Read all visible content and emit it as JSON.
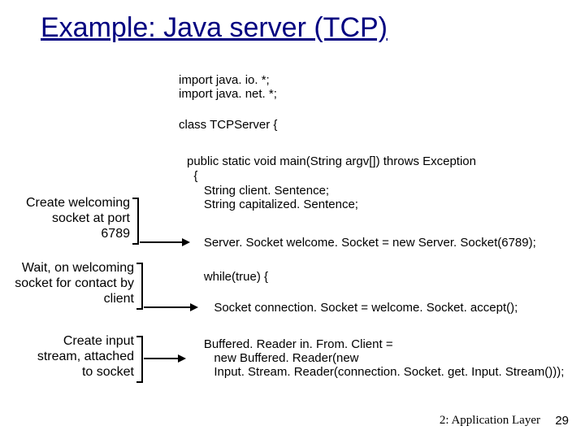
{
  "title": "Example: Java server (TCP)",
  "code": {
    "imports": "import java. io. *;\nimport java. net. *;",
    "classdecl": "class TCPServer {",
    "mainsig": "public static void main(String argv[]) throws Exception",
    "brace": "  {",
    "decls": "     String client. Sentence;\n     String capitalized. Sentence;",
    "welcome": "     Server. Socket welcome. Socket = new Server. Socket(6789);",
    "whileline": "     while(true) {",
    "accept": "        Socket connection. Socket = welcome. Socket. accept();",
    "reader": "     Buffered. Reader in. From. Client =\n        new Buffered. Reader(new\n        Input. Stream. Reader(connection. Socket. get. Input. Stream()));"
  },
  "annotations": {
    "a1": "Create\nwelcoming socket\nat port 6789",
    "a2": "Wait, on welcoming\nsocket for contact\nby client",
    "a3": "Create input\nstream, attached\nto socket"
  },
  "footer": {
    "label": "2: Application Layer",
    "page": "29"
  }
}
